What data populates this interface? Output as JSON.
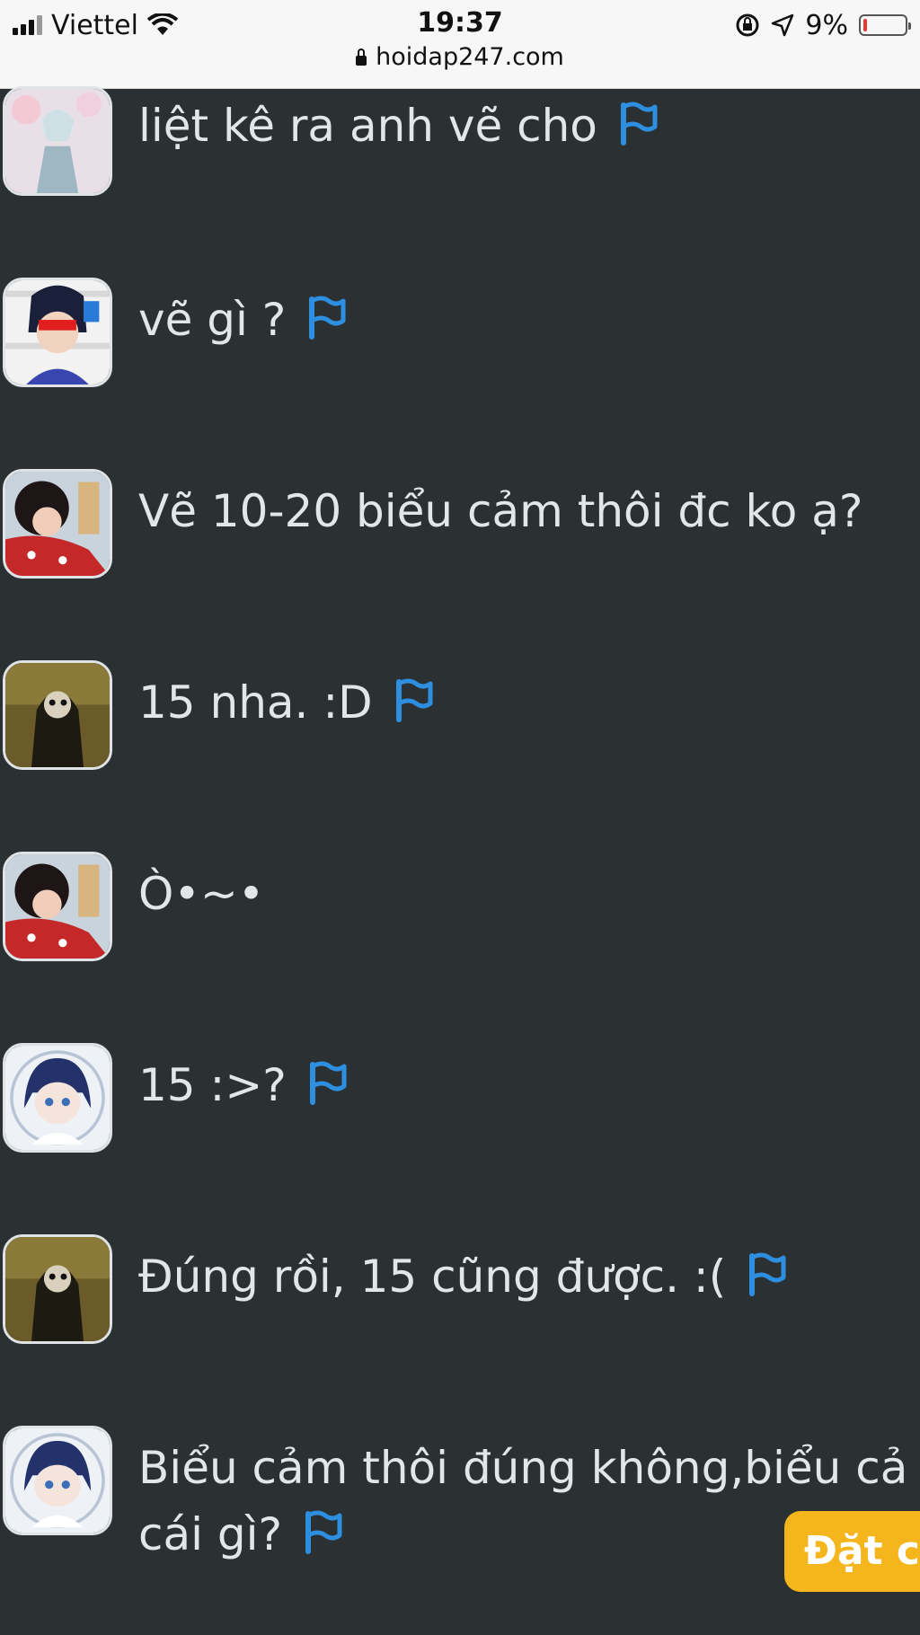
{
  "status": {
    "carrier": "Viettel",
    "time": "19:37",
    "battery_percent": "9%",
    "battery_level": 0.09,
    "url": "hoidap247.com"
  },
  "messages": [
    {
      "text": "liệt kê ra anh vẽ cho",
      "flag": true,
      "avatar": "anime-boy-white"
    },
    {
      "text": "vẽ gì ?",
      "flag": true,
      "avatar": "supreme-boy"
    },
    {
      "text": "Vẽ 10-20 biểu cảm thôi đc ko ạ?",
      "flag": false,
      "avatar": "girl-red-shirt"
    },
    {
      "text": "15 nha. :D",
      "flag": true,
      "avatar": "mona-lisa-mask"
    },
    {
      "text": "Ò•~•",
      "flag": false,
      "avatar": "girl-red-shirt"
    },
    {
      "text": "15 :>?",
      "flag": true,
      "avatar": "anime-boy-blue"
    },
    {
      "text": "Đúng rồi, 15 cũng được. :(",
      "flag": true,
      "avatar": "mona-lisa-mask"
    },
    {
      "text": "Biểu cảm thôi đúng không,biểu cả",
      "text2": "cái gì?",
      "flag": true,
      "avatar": "anime-boy-blue"
    }
  ],
  "cta_label": "Đặt c",
  "colors": {
    "flag": "#2e8ee0",
    "cta": "#f5b51c",
    "background": "#2b3033"
  }
}
